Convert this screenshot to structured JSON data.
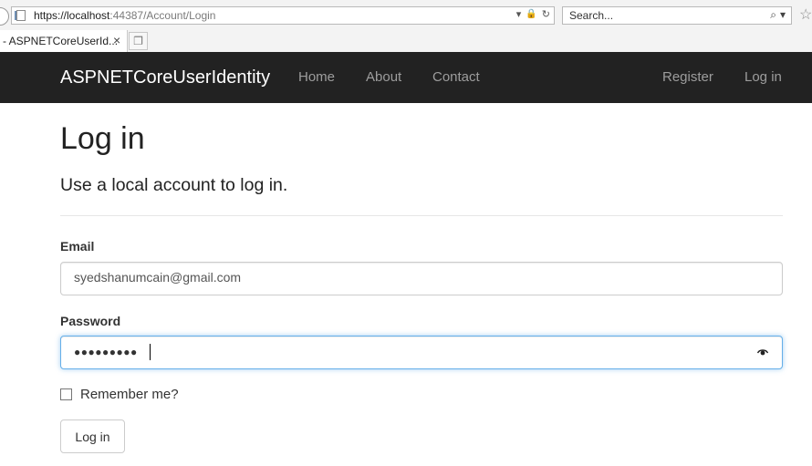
{
  "browser": {
    "url_scheme_host": "https://localhost",
    "url_rest": ":44387/Account/Login",
    "search_placeholder": "Search...",
    "tab_title": "- ASPNETCoreUserId..."
  },
  "navbar": {
    "brand": "ASPNETCoreUserIdentity",
    "links": [
      "Home",
      "About",
      "Contact"
    ],
    "register": "Register",
    "login": "Log in"
  },
  "page": {
    "title": "Log in",
    "subtitle": "Use a local account to log in."
  },
  "form": {
    "email_label": "Email",
    "email_value": "syedshanumcain@gmail.com",
    "password_label": "Password",
    "password_mask": "●●●●●●●●●",
    "remember_label": "Remember me?",
    "submit_label": "Log in"
  },
  "icons": {
    "tab_close": "×",
    "lock": "🔒",
    "refresh": "↻",
    "search": "⌕",
    "favorite": "☆"
  }
}
